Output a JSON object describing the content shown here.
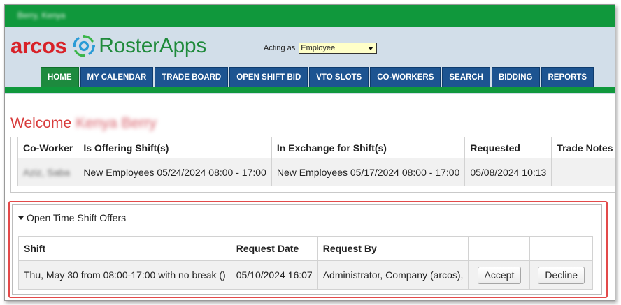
{
  "user": {
    "name": "Berry, Kenya"
  },
  "header": {
    "logo_arcos": "arcos",
    "logo_roster": "RosterApps",
    "acting_label": "Acting as",
    "acting_value": "Employee"
  },
  "nav": {
    "tabs": [
      {
        "label": "HOME",
        "active": true
      },
      {
        "label": "MY CALENDAR"
      },
      {
        "label": "TRADE BOARD"
      },
      {
        "label": "OPEN SHIFT BID"
      },
      {
        "label": "VTO SLOTS"
      },
      {
        "label": "CO-WORKERS"
      },
      {
        "label": "SEARCH"
      },
      {
        "label": "BIDDING"
      },
      {
        "label": "REPORTS"
      }
    ]
  },
  "welcome": {
    "label": "Welcome",
    "name": "Kenya Berry"
  },
  "trades": {
    "columns": [
      "Co-Worker",
      "Is Offering Shift(s)",
      "In Exchange for Shift(s)",
      "Requested",
      "Trade Notes"
    ],
    "rows": [
      {
        "coworker": "Aziz, Saba",
        "offering": "New Employees 05/24/2024 08:00 - 17:00",
        "exchange": "New Employees 05/17/2024 08:00 - 17:00",
        "requested": "05/08/2024 10:13",
        "notes": ""
      }
    ]
  },
  "offers": {
    "title": "Open Time Shift Offers",
    "columns": [
      "Shift",
      "Request Date",
      "Request By",
      "",
      ""
    ],
    "rows": [
      {
        "shift": "Thu, May 30 from 08:00-17:00 with no break ()",
        "request_date": "05/10/2024 16:07",
        "request_by": "Administrator, Company (arcos),",
        "accept_label": "Accept",
        "decline_label": "Decline"
      }
    ]
  },
  "colors": {
    "green": "#10983c",
    "header_bg": "#d2dee9",
    "nav_blue": "#1d5491",
    "highlight": "#e34a4a",
    "welcome": "#d83b3b"
  }
}
